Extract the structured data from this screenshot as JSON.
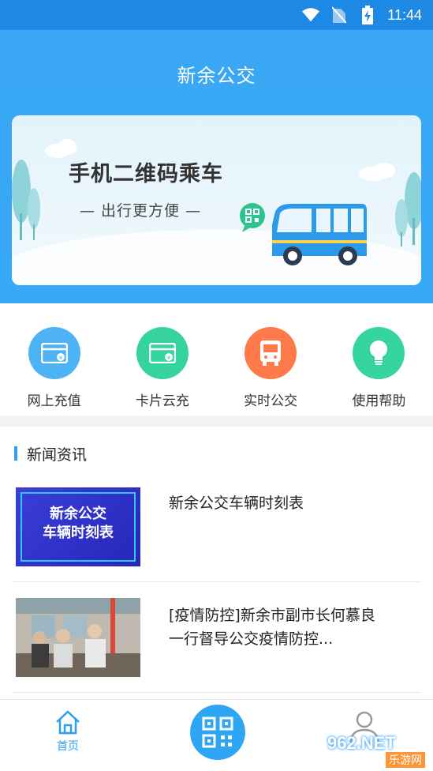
{
  "status_bar": {
    "time": "11:44",
    "icons": [
      "wifi-icon",
      "no-sim-icon",
      "battery-charging-icon"
    ]
  },
  "header": {
    "title": "新余公交"
  },
  "banner": {
    "title": "手机二维码乘车",
    "subtitle": "— 出行更方便 —"
  },
  "menu": {
    "items": [
      {
        "label": "网上充值",
        "icon": "wallet-card-icon",
        "color": "#4db3f5"
      },
      {
        "label": "卡片云充",
        "icon": "card-recharge-icon",
        "color": "#35d3a0"
      },
      {
        "label": "实时公交",
        "icon": "bus-icon",
        "color": "#ff7a4a"
      },
      {
        "label": "使用帮助",
        "icon": "lightbulb-icon",
        "color": "#35d3a0"
      }
    ]
  },
  "news": {
    "heading": "新闻资讯",
    "items": [
      {
        "title": "新余公交车辆时刻表",
        "thumb_text_line1": "新余公交",
        "thumb_text_line2": "车辆时刻表"
      },
      {
        "title": "[疫情防控]新余市副市长何慕良一行督导公交疫情防控..."
      }
    ]
  },
  "bottom_nav": {
    "home_label": "首页",
    "watermark_text": "962.NET",
    "watermark_sub": "乐游网"
  },
  "colors": {
    "primary": "#37a9f6",
    "accent_blue": "#2f9ef0",
    "status_bar": "#1e88e5"
  }
}
